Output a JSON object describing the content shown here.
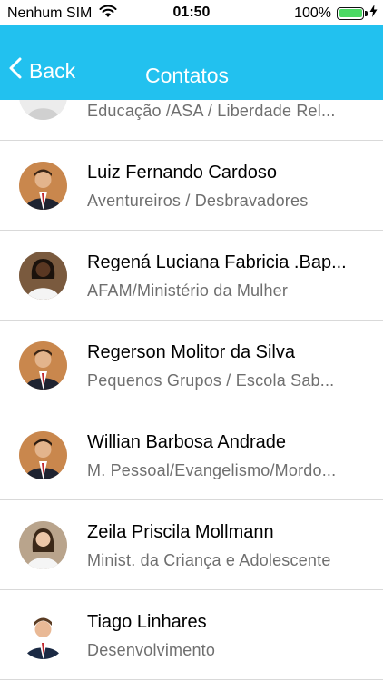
{
  "status_bar": {
    "carrier": "Nenhum SIM",
    "time": "01:50",
    "battery": "100%",
    "battery_level": 1.0,
    "icons": [
      "wifi-icon",
      "battery-icon",
      "charging-bolt-icon"
    ]
  },
  "nav": {
    "back_label": "Back",
    "title": "Contatos",
    "color": "#22c1ef"
  },
  "contacts": [
    {
      "name": "",
      "subtitle": "Educação /ASA / Liberdade Rel...",
      "avatar": "placeholder-avatar"
    },
    {
      "name": "Luiz Fernando Cardoso",
      "subtitle": "Aventureiros / Desbravadores",
      "avatar": "man-suit-red-tie"
    },
    {
      "name": "Regená Luciana Fabricia .Bap...",
      "subtitle": "AFAM/Ministério da Mulher",
      "avatar": "woman-white-top"
    },
    {
      "name": "Regerson Molitor da Silva",
      "subtitle": "Pequenos Grupos / Escola Sab...",
      "avatar": "man-suit-red-tie"
    },
    {
      "name": "Willian Barbosa Andrade",
      "subtitle": "M. Pessoal/Evangelismo/Mordo...",
      "avatar": "man-suit-red-tie"
    },
    {
      "name": "Zeila Priscila Mollmann",
      "subtitle": "Minist. da Criança e Adolescente",
      "avatar": "woman-white-top"
    },
    {
      "name": "Tiago Linhares",
      "subtitle": "Desenvolvimento",
      "avatar": "man-suit-cutout"
    }
  ]
}
